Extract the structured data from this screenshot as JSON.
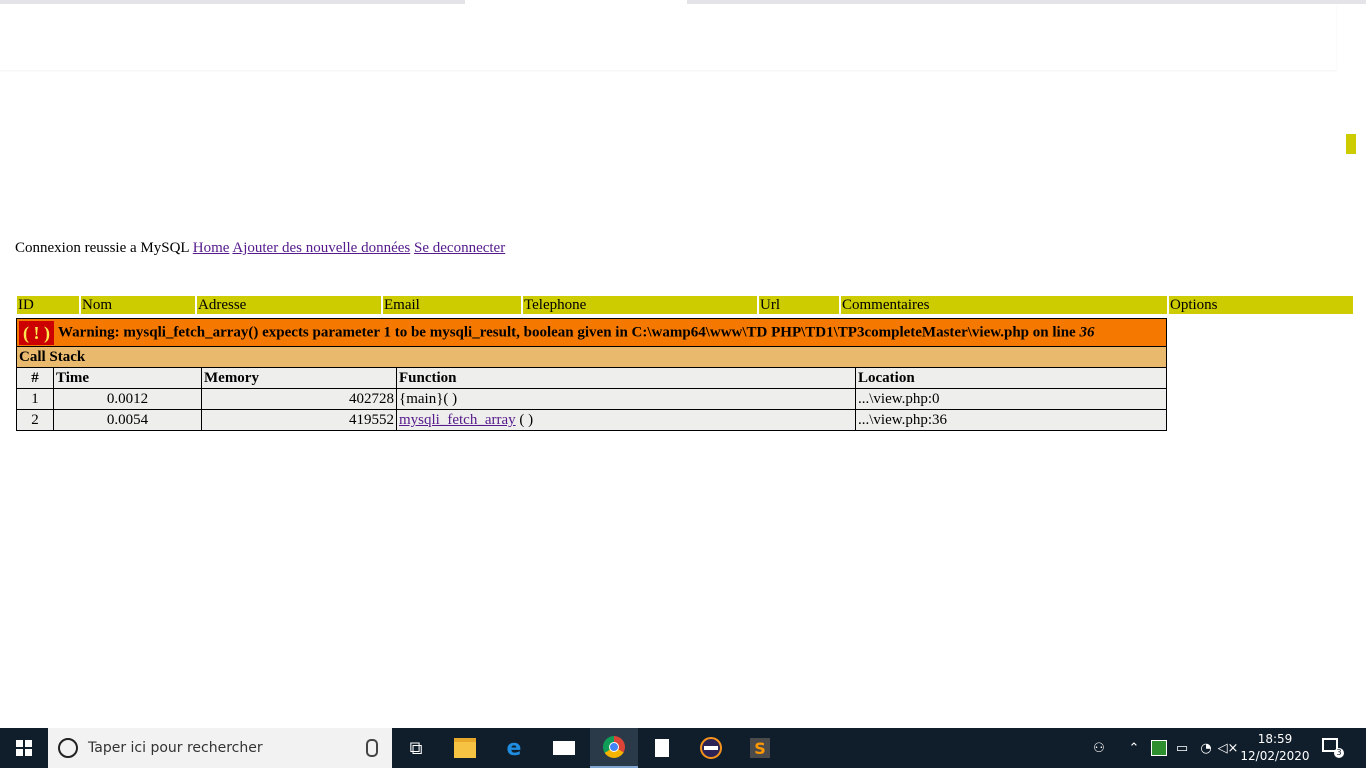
{
  "page": {
    "connexion_text": "Connexion reussie a MySQL",
    "links": {
      "home": "Home",
      "ajouter": "Ajouter des nouvelle données",
      "deconnecter": "Se deconnecter"
    }
  },
  "table_header": [
    "ID",
    "Nom",
    "Adresse",
    "Email",
    "Telephone",
    "Url",
    "Commentaires",
    "Options"
  ],
  "xdebug": {
    "icon": "( ! )",
    "warning_prefix": "Warning: mysqli_fetch_array() expects parameter 1 to be mysqli_result, boolean given in C:\\wamp64\\www\\TD PHP\\TD1\\TP3completeMaster\\view.php on line",
    "warning_line": "36",
    "call_stack_title": "Call Stack",
    "columns": [
      "#",
      "Time",
      "Memory",
      "Function",
      "Location"
    ],
    "rows": [
      {
        "num": "1",
        "time": "0.0012",
        "memory": "402728",
        "function": "{main}( )",
        "function_link": "",
        "function_suffix": "",
        "location": "...\\view.php:0"
      },
      {
        "num": "2",
        "time": "0.0054",
        "memory": "419552",
        "function": "",
        "function_link": "mysqli_fetch_array",
        "function_suffix": " ( )",
        "location": "...\\view.php:36"
      }
    ],
    "colors": {
      "warning_bg": "#f57900",
      "callstack_bg": "#e9b96e",
      "row_bg": "#eeeeec",
      "icon_bg": "#cc0000"
    }
  },
  "header_color": "#cccc00",
  "taskbar": {
    "search_placeholder": "Taper ici pour rechercher",
    "time": "18:59",
    "date": "12/02/2020",
    "notification_count": "3",
    "apps": [
      "task-view-icon",
      "file-explorer-icon",
      "edge-icon",
      "mail-icon",
      "chrome-icon",
      "notepad-icon",
      "eclipse-icon",
      "sublime-icon"
    ],
    "tray": [
      "people-icon",
      "chevron-up-icon",
      "wamp-icon",
      "battery-icon",
      "wifi-icon",
      "volume-muted-icon"
    ]
  }
}
